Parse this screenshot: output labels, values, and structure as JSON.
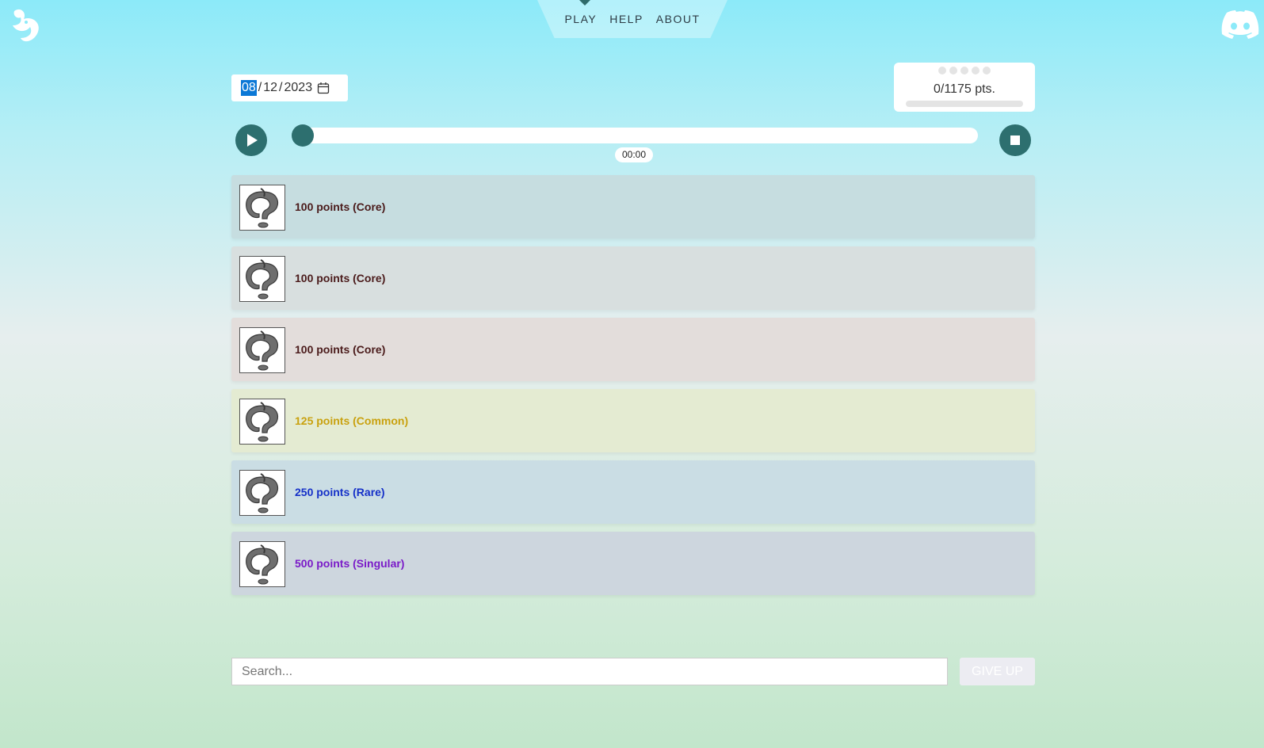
{
  "nav": {
    "links": [
      "PLAY",
      "HELP",
      "ABOUT"
    ]
  },
  "date": {
    "month": "08",
    "day": "12",
    "year": "2023",
    "separator": "/"
  },
  "score": {
    "text": "0/1175 pts.",
    "earned": 0,
    "total": 1175,
    "dots_total": 5
  },
  "player": {
    "time": "00:00",
    "progress": 0
  },
  "tracks": [
    {
      "label": "100 points (Core)",
      "color": "#4a1a1a",
      "bg": "#c6dde0"
    },
    {
      "label": "100 points (Core)",
      "color": "#4a1a1a",
      "bg": "#d8dfdf"
    },
    {
      "label": "100 points (Core)",
      "color": "#4a1a1a",
      "bg": "#e3dddb"
    },
    {
      "label": "125 points (Common)",
      "color": "#c9a10e",
      "bg": "#e4ebd2"
    },
    {
      "label": "250 points (Rare)",
      "color": "#1530c8",
      "bg": "#cadde4"
    },
    {
      "label": "500 points (Singular)",
      "color": "#7a1ac8",
      "bg": "#cdd6de"
    }
  ],
  "search": {
    "placeholder": "Search..."
  },
  "giveup": {
    "label": "GIVE UP"
  }
}
